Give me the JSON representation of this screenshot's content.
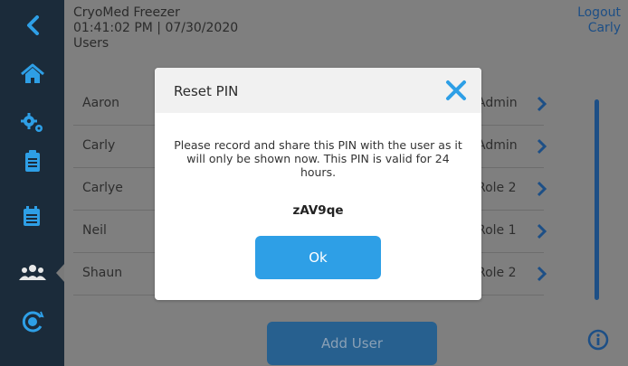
{
  "header": {
    "device_name": "CryoMed Freezer",
    "datetime": "01:41:02 PM | 07/30/2020",
    "page_title": "Users",
    "logout_label": "Logout",
    "current_user": "Carly"
  },
  "sidebar": {
    "items": [
      {
        "icon": "back-chevron-icon"
      },
      {
        "icon": "home-icon"
      },
      {
        "icon": "gears-icon"
      },
      {
        "icon": "clipboard-icon"
      },
      {
        "icon": "calendar-icon"
      },
      {
        "icon": "users-icon",
        "active": true
      },
      {
        "icon": "calibration-icon"
      }
    ]
  },
  "users": [
    {
      "name": "Aaron",
      "role": "Admin"
    },
    {
      "name": "Carly",
      "role": "Admin"
    },
    {
      "name": "Carlye",
      "role": "Role 2"
    },
    {
      "name": "Neil",
      "role": "Role 1"
    },
    {
      "name": "Shaun",
      "role": "Role 2"
    }
  ],
  "add_user_label": "Add User",
  "modal": {
    "title": "Reset PIN",
    "message": "Please record and share this PIN with the user as it will only be shown now. This PIN is valid for 24 hours.",
    "pin": "zAV9qe",
    "ok_label": "Ok"
  },
  "colors": {
    "sidebar_bg": "#1b2b3a",
    "accent": "#2e9fe6",
    "link": "#1d4f86"
  }
}
